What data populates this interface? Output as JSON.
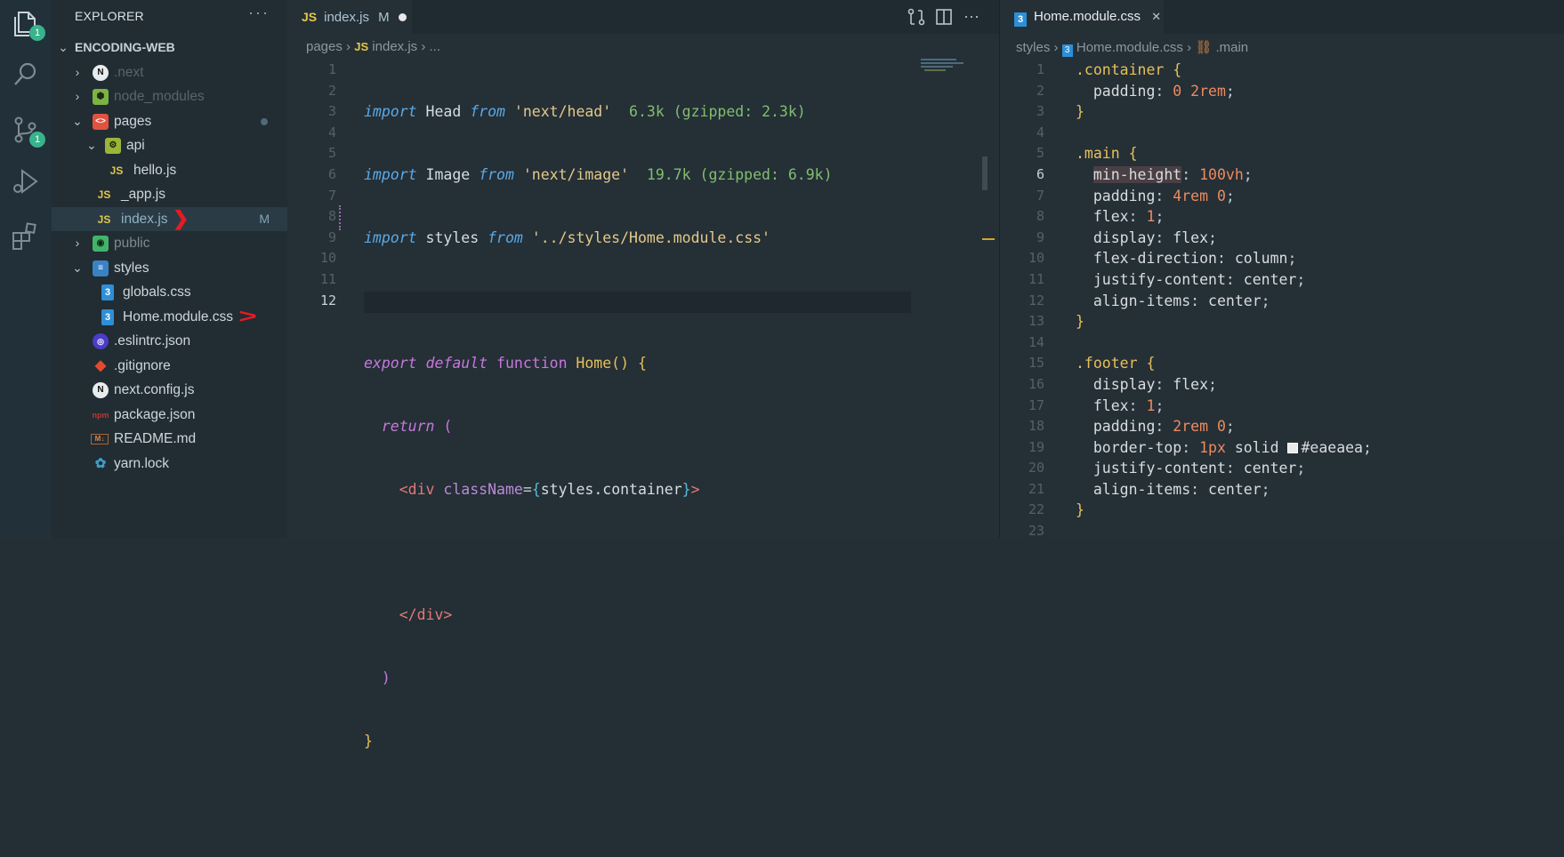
{
  "activity": {
    "explorer_badge": "1",
    "scm_badge": "1"
  },
  "explorer": {
    "title": "EXPLORER",
    "more": "···",
    "root": "ENCODING-WEB",
    "items": [
      {
        "label": ".next",
        "icon": "next-folder-icon"
      },
      {
        "label": "node_modules",
        "icon": "node-folder-icon"
      },
      {
        "label": "pages",
        "icon": "pages-folder-icon"
      },
      {
        "label": "api",
        "icon": "api-folder-icon"
      },
      {
        "label": "hello.js",
        "icon": "js-icon"
      },
      {
        "label": "_app.js",
        "icon": "js-icon"
      },
      {
        "label": "index.js",
        "icon": "js-icon",
        "badge": "M"
      },
      {
        "label": "public",
        "icon": "public-folder-icon"
      },
      {
        "label": "styles",
        "icon": "styles-folder-icon"
      },
      {
        "label": "globals.css",
        "icon": "css-icon"
      },
      {
        "label": "Home.module.css",
        "icon": "css-icon"
      },
      {
        "label": ".eslintrc.json",
        "icon": "eslint-icon"
      },
      {
        "label": ".gitignore",
        "icon": "git-icon"
      },
      {
        "label": "next.config.js",
        "icon": "next-icon"
      },
      {
        "label": "package.json",
        "icon": "npm-icon"
      },
      {
        "label": "README.md",
        "icon": "markdown-icon"
      },
      {
        "label": "yarn.lock",
        "icon": "yarn-icon"
      }
    ],
    "js_label": "JS"
  },
  "editor1": {
    "tab": {
      "label": "index.js",
      "modified": "M"
    },
    "breadcrumb": {
      "folder": "pages",
      "file": "index.js",
      "rest": "..."
    },
    "lines": [
      "1",
      "2",
      "3",
      "4",
      "5",
      "6",
      "7",
      "8",
      "9",
      "10",
      "11",
      "12"
    ],
    "code": {
      "l1": {
        "kw": "import",
        "name": " Head ",
        "from": "from",
        "str": " 'next/head'",
        "size": "  6.3k (gzipped: 2.3k)"
      },
      "l2": {
        "kw": "import",
        "name": " Image ",
        "from": "from",
        "str": " 'next/image'",
        "size": "  19.7k (gzipped: 6.9k)"
      },
      "l3": {
        "kw": "import",
        "name": " styles ",
        "from": "from",
        "str": " '../styles/Home.module.css'"
      },
      "l5": {
        "exp": "export",
        "def": " default",
        "fn": " function",
        "name": " Home",
        "rest": "() {"
      },
      "l6": {
        "ret": "return",
        "paren": " ("
      },
      "l7": {
        "open": "<div",
        "attr": " className",
        "eq": "=",
        "b1": "{",
        "expr": "styles.container",
        "b2": "}",
        "close": ">"
      },
      "l9": {
        "close": "</div>"
      },
      "l10": {
        "paren": ")"
      },
      "l11": {
        "brace": "}"
      }
    }
  },
  "editor2": {
    "tab": {
      "label": "Home.module.css",
      "close": "✕"
    },
    "breadcrumb": {
      "folder": "styles",
      "file": "Home.module.css",
      "symbol": ".main"
    },
    "lines": [
      "1",
      "2",
      "3",
      "4",
      "5",
      "6",
      "7",
      "8",
      "9",
      "10",
      "11",
      "12",
      "13",
      "14",
      "15",
      "16",
      "17",
      "18",
      "19",
      "20",
      "21",
      "22",
      "23"
    ],
    "code": [
      {
        "sel": ".container",
        "brace": " {"
      },
      {
        "prop": "padding",
        "vals": [
          [
            "num",
            "0"
          ],
          [
            "val",
            " "
          ],
          [
            "num",
            "2rem"
          ]
        ]
      },
      {
        "brace": "}"
      },
      {},
      {
        "sel": ".main",
        "brace": " {"
      },
      {
        "prop": "min-height",
        "vals": [
          [
            "num",
            "100vh"
          ]
        ],
        "hl": true
      },
      {
        "prop": "padding",
        "vals": [
          [
            "num",
            "4rem"
          ],
          [
            "val",
            " "
          ],
          [
            "num",
            "0"
          ]
        ]
      },
      {
        "prop": "flex",
        "vals": [
          [
            "num",
            "1"
          ]
        ]
      },
      {
        "prop": "display",
        "vals": [
          [
            "val",
            "flex"
          ]
        ]
      },
      {
        "prop": "flex-direction",
        "vals": [
          [
            "val",
            "column"
          ]
        ]
      },
      {
        "prop": "justify-content",
        "vals": [
          [
            "val",
            "center"
          ]
        ]
      },
      {
        "prop": "align-items",
        "vals": [
          [
            "val",
            "center"
          ]
        ]
      },
      {
        "brace": "}"
      },
      {},
      {
        "sel": ".footer",
        "brace": " {"
      },
      {
        "prop": "display",
        "vals": [
          [
            "val",
            "flex"
          ]
        ]
      },
      {
        "prop": "flex",
        "vals": [
          [
            "num",
            "1"
          ]
        ]
      },
      {
        "prop": "padding",
        "vals": [
          [
            "num",
            "2rem"
          ],
          [
            "val",
            " "
          ],
          [
            "num",
            "0"
          ]
        ]
      },
      {
        "prop": "border-top",
        "vals": [
          [
            "num",
            "1px"
          ],
          [
            "val",
            " solid "
          ],
          [
            "swatch",
            "#eaeaea"
          ]
        ]
      },
      {
        "prop": "justify-content",
        "vals": [
          [
            "val",
            "center"
          ]
        ]
      },
      {
        "prop": "align-items",
        "vals": [
          [
            "val",
            "center"
          ]
        ]
      },
      {
        "brace": "}"
      },
      {}
    ]
  },
  "colors": {
    "accent": "#38b38c",
    "js": "#e1c84a",
    "css": "#2d8fd6",
    "annotation": "#e51b24"
  }
}
